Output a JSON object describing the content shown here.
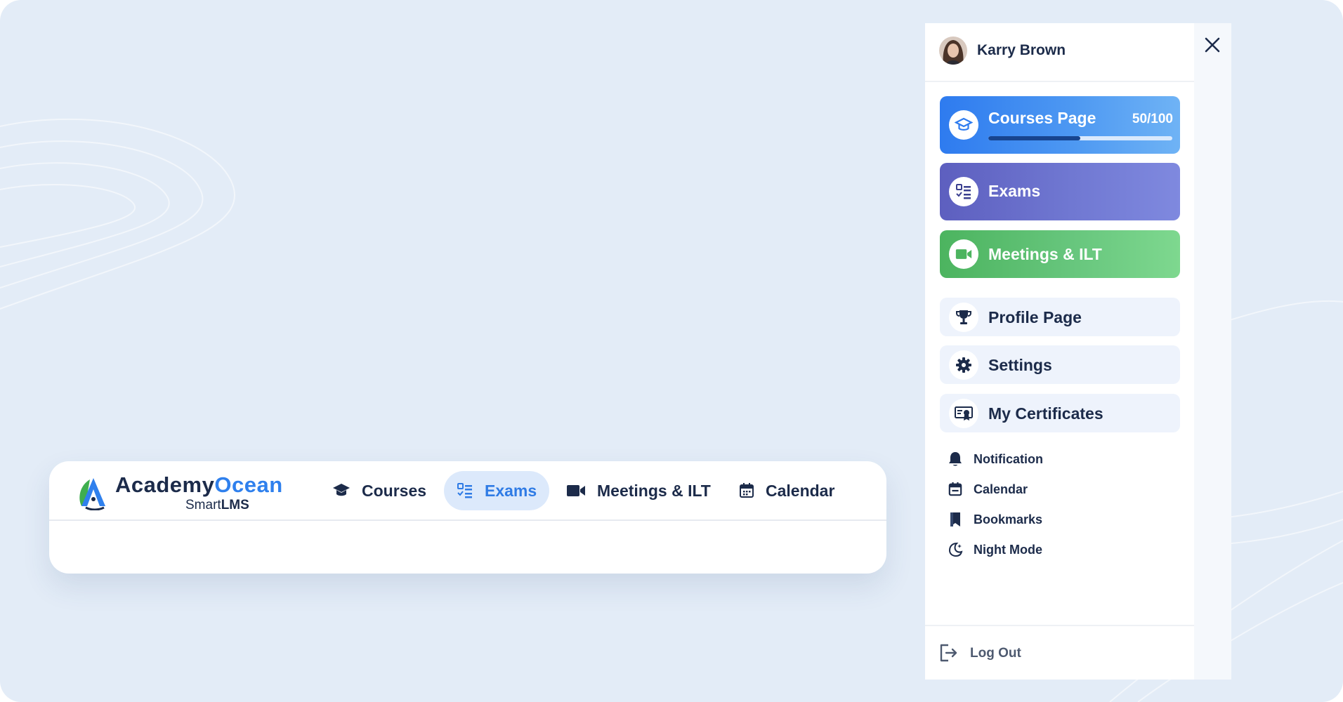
{
  "brand": {
    "name_part1": "Academy",
    "name_part2": "Ocean",
    "sub_part1": "Smart",
    "sub_part2": "LMS",
    "colors": {
      "primary": "#2f80ed",
      "dark": "#1c2b4a"
    }
  },
  "navbar": {
    "items": [
      {
        "label": "Courses",
        "icon": "graduation-cap-icon",
        "active": false
      },
      {
        "label": "Exams",
        "icon": "checklist-icon",
        "active": true
      },
      {
        "label": "Meetings & ILT",
        "icon": "video-camera-icon",
        "active": false
      },
      {
        "label": "Calendar",
        "icon": "calendar-icon",
        "active": false
      }
    ]
  },
  "drawer": {
    "user": {
      "name": "Karry Brown",
      "avatar_icon": "avatar-photo"
    },
    "close_icon": "close-icon",
    "tiles": [
      {
        "label": "Courses Page",
        "count": "50/100",
        "progress": 0.5,
        "icon": "graduation-cap-icon",
        "color": "#2e7bef"
      },
      {
        "label": "Exams",
        "icon": "checklist-icon",
        "color": "#6a6fcb"
      },
      {
        "label": "Meetings & ILT",
        "icon": "video-camera-icon",
        "color": "#5fbf72"
      }
    ],
    "menu": [
      {
        "label": "Profile Page",
        "icon": "trophy-icon"
      },
      {
        "label": "Settings",
        "icon": "gear-icon"
      },
      {
        "label": "My Certificates",
        "icon": "certificate-icon"
      }
    ],
    "small_items": [
      {
        "label": "Notification",
        "icon": "bell-icon"
      },
      {
        "label": "Calendar",
        "icon": "calendar-icon"
      },
      {
        "label": "Bookmarks",
        "icon": "bookmark-icon"
      },
      {
        "label": "Night Mode",
        "icon": "moon-icon"
      }
    ],
    "logout": {
      "label": "Log Out",
      "icon": "logout-icon"
    }
  }
}
